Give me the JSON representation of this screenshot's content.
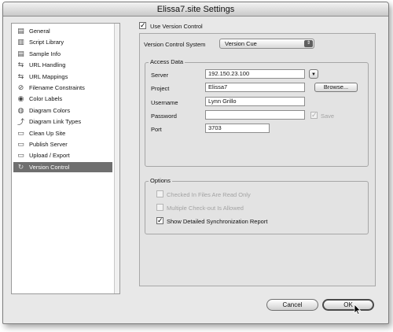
{
  "window": {
    "title": "Elissa7.site Settings"
  },
  "sidebar": {
    "items": [
      {
        "label": "General",
        "icon": "general-icon",
        "glyph": "▤"
      },
      {
        "label": "Script Library",
        "icon": "script-library-icon",
        "glyph": "▥"
      },
      {
        "label": "Sample Info",
        "icon": "sample-info-icon",
        "glyph": "▤"
      },
      {
        "label": "URL Handling",
        "icon": "url-handling-icon",
        "glyph": "⇆"
      },
      {
        "label": "URL Mappings",
        "icon": "url-mappings-icon",
        "glyph": "⇆"
      },
      {
        "label": "Filename Constraints",
        "icon": "filename-constraints-icon",
        "glyph": "⊘"
      },
      {
        "label": "Color Labels",
        "icon": "color-labels-icon",
        "glyph": "◉"
      },
      {
        "label": "Diagram Colors",
        "icon": "diagram-colors-icon",
        "glyph": "◍"
      },
      {
        "label": "Diagram Link Types",
        "icon": "diagram-link-types-icon",
        "glyph": "⤴"
      },
      {
        "label": "Clean Up Site",
        "icon": "clean-up-site-icon",
        "glyph": "▭"
      },
      {
        "label": "Publish Server",
        "icon": "publish-server-icon",
        "glyph": "▭"
      },
      {
        "label": "Upload / Export",
        "icon": "upload-export-icon",
        "glyph": "▭"
      },
      {
        "label": "Version Control",
        "icon": "version-control-icon",
        "glyph": "↻",
        "selected": true
      }
    ]
  },
  "main": {
    "use_version_control_label": "Use Version Control",
    "use_version_control_checked": "✓",
    "vcs_label": "Version Control System",
    "vcs_value": "Version Cue",
    "access": {
      "title": "Access Data",
      "server_label": "Server",
      "server_value": "192.150.23.100",
      "project_label": "Project",
      "project_value": "Elissa7",
      "browse_label": "Browse...",
      "username_label": "Username",
      "username_value": "Lynn Grillo",
      "password_label": "Password",
      "password_value": "",
      "save_label": "Save",
      "save_checked": "✓",
      "port_label": "Port",
      "port_value": "3703"
    },
    "options": {
      "title": "Options",
      "readonly_label": "Checked In Files Are Read Only",
      "multiple_label": "Multiple Check-out Is Allowed",
      "sync_label": "Show Detailed Synchronization Report",
      "sync_checked": "✓"
    }
  },
  "buttons": {
    "cancel": "Cancel",
    "ok": "OK"
  }
}
